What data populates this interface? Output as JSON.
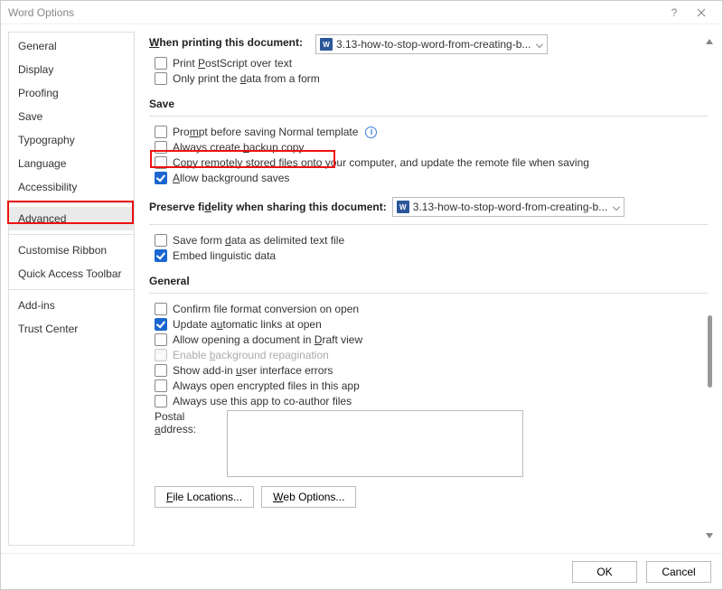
{
  "window": {
    "title": "Word Options"
  },
  "sidebar": {
    "items": [
      {
        "label": "General"
      },
      {
        "label": "Display"
      },
      {
        "label": "Proofing"
      },
      {
        "label": "Save"
      },
      {
        "label": "Typography"
      },
      {
        "label": "Language"
      },
      {
        "label": "Accessibility"
      },
      {
        "label": "Advanced",
        "selected": true
      },
      {
        "label": "Customise Ribbon"
      },
      {
        "label": "Quick Access Toolbar"
      },
      {
        "label": "Add-ins"
      },
      {
        "label": "Trust Center"
      }
    ]
  },
  "printing": {
    "heading_label": "When printing this document:",
    "doc_name": "3.13-how-to-stop-word-from-creating-b...",
    "postscript_label": "Print PostScript over text",
    "only_data_label": "Only print the data from a form"
  },
  "save": {
    "heading_label": "Save",
    "prompt_normal_label": "Prompt before saving Normal template",
    "backup_label": "Always create backup copy",
    "copy_remote_label": "Copy remotely stored files onto your computer, and update the remote file when saving",
    "bg_saves_label": "Allow background saves"
  },
  "fidelity": {
    "heading_label": "Preserve fidelity when sharing this document:",
    "doc_name": "3.13-how-to-stop-word-from-creating-b...",
    "save_form_label": "Save form data as delimited text file",
    "embed_ling_label": "Embed linguistic data"
  },
  "general": {
    "heading_label": "General",
    "confirm_conversion_label": "Confirm file format conversion on open",
    "update_links_label": "Update automatic links at open",
    "draft_view_label": "Allow opening a document in Draft view",
    "bg_repag_label": "Enable background repagination",
    "addin_errors_label": "Show add-in user interface errors",
    "encrypted_label": "Always open encrypted files in this app",
    "coauthor_label": "Always use this app to co-author files",
    "postal_label": "Postal address:",
    "file_locations_btn": "File Locations...",
    "web_options_btn": "Web Options..."
  },
  "footer": {
    "ok_label": "OK",
    "cancel_label": "Cancel"
  }
}
